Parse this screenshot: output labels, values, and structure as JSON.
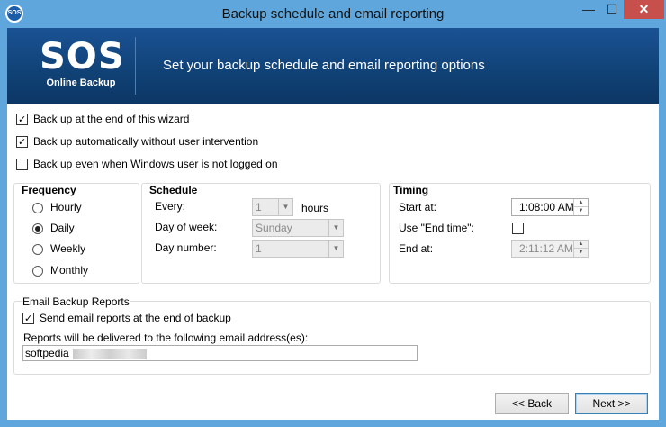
{
  "window": {
    "app_icon_text": "SOS",
    "title": "Backup schedule and email reporting",
    "min_glyph": "—",
    "max_glyph": "☐",
    "close_glyph": "✕"
  },
  "banner": {
    "logo_main": "SOS",
    "logo_sub": "Online Backup",
    "heading": "Set your backup schedule and email reporting options"
  },
  "options": [
    {
      "label": "Back up at the end of this wizard",
      "checked": true
    },
    {
      "label": "Back up automatically without user intervention",
      "checked": true
    },
    {
      "label": "Back up even when Windows user is not logged on",
      "checked": false
    }
  ],
  "frequency": {
    "title": "Frequency",
    "options": [
      "Hourly",
      "Daily",
      "Weekly",
      "Monthly"
    ],
    "selected": "Daily"
  },
  "schedule": {
    "title": "Schedule",
    "every_label": "Every:",
    "every_value": "1",
    "every_unit": "hours",
    "day_of_week_label": "Day of week:",
    "day_of_week_value": "Sunday",
    "day_number_label": "Day number:",
    "day_number_value": "1"
  },
  "timing": {
    "title": "Timing",
    "start_label": "Start at:",
    "start_value": "1:08:00 AM",
    "use_end_label": "Use \"End time\":",
    "use_end_checked": false,
    "end_label": "End at:",
    "end_value": "2:11:12 AM"
  },
  "email": {
    "title": "Email Backup Reports",
    "send_label": "Send email reports at the end of backup",
    "send_checked": true,
    "address_label": "Reports will be delivered to the following email address(es):",
    "address_value": "softpedia"
  },
  "buttons": {
    "back": "<< Back",
    "next": "Next >>"
  }
}
